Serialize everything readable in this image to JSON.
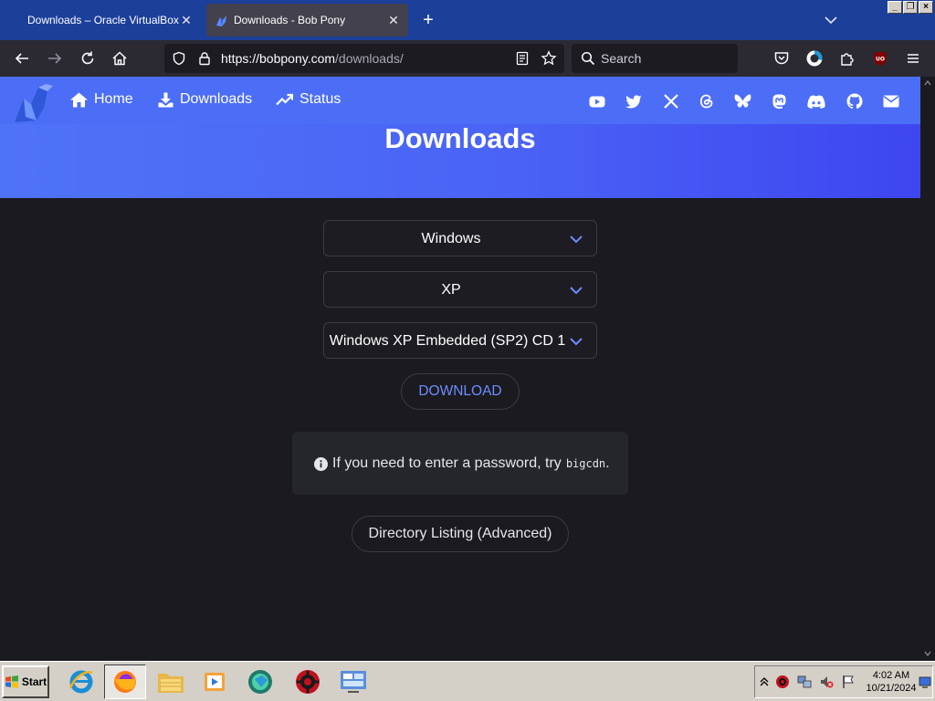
{
  "browser": {
    "tabs": [
      {
        "label": "Downloads – Oracle VirtualBox",
        "active": false
      },
      {
        "label": "Downloads - Bob Pony",
        "active": true
      }
    ],
    "window_controls": [
      "_",
      "❐",
      "×"
    ],
    "url": {
      "host": "https://bobpony.com",
      "path": "/downloads/"
    },
    "search_placeholder": "Search",
    "icons": [
      "back-icon",
      "forward-icon",
      "reload-icon",
      "home-icon",
      "shield-icon",
      "lock-icon",
      "reader-view-icon",
      "bookmark-star-icon",
      "search-icon",
      "pocket-icon",
      "profile-icon",
      "extensions-icon",
      "ublock-icon",
      "menu-icon"
    ]
  },
  "site": {
    "nav": [
      {
        "label": "Home",
        "icon": "home-icon"
      },
      {
        "label": "Downloads",
        "icon": "download-icon"
      },
      {
        "label": "Status",
        "icon": "trending-up-icon"
      }
    ],
    "social_icons": [
      "youtube-icon",
      "twitter-icon",
      "x-icon",
      "threads-icon",
      "bluesky-icon",
      "mastodon-icon",
      "discord-icon",
      "github-icon",
      "email-icon"
    ],
    "title": "Downloads",
    "accent": "#4c6ef7"
  },
  "form": {
    "os": "Windows",
    "version": "XP",
    "file": "Windows XP Embedded (SP2) CD 1",
    "download_label": "DOWNLOAD",
    "notice_text": "If you need to enter a password, try",
    "notice_code": "bigcdn",
    "notice_end": ".",
    "directory_label": "Directory Listing (Advanced)"
  },
  "taskbar": {
    "start_label": "Start",
    "apps": [
      "internet-explorer-icon",
      "firefox-icon",
      "folder-icon",
      "media-player-icon",
      "virtualbox-icon",
      "settings-gear-icon",
      "control-panel-icon"
    ],
    "active_app": "firefox-icon",
    "clock_time": "4:02 AM",
    "clock_date": "10/21/2024"
  }
}
